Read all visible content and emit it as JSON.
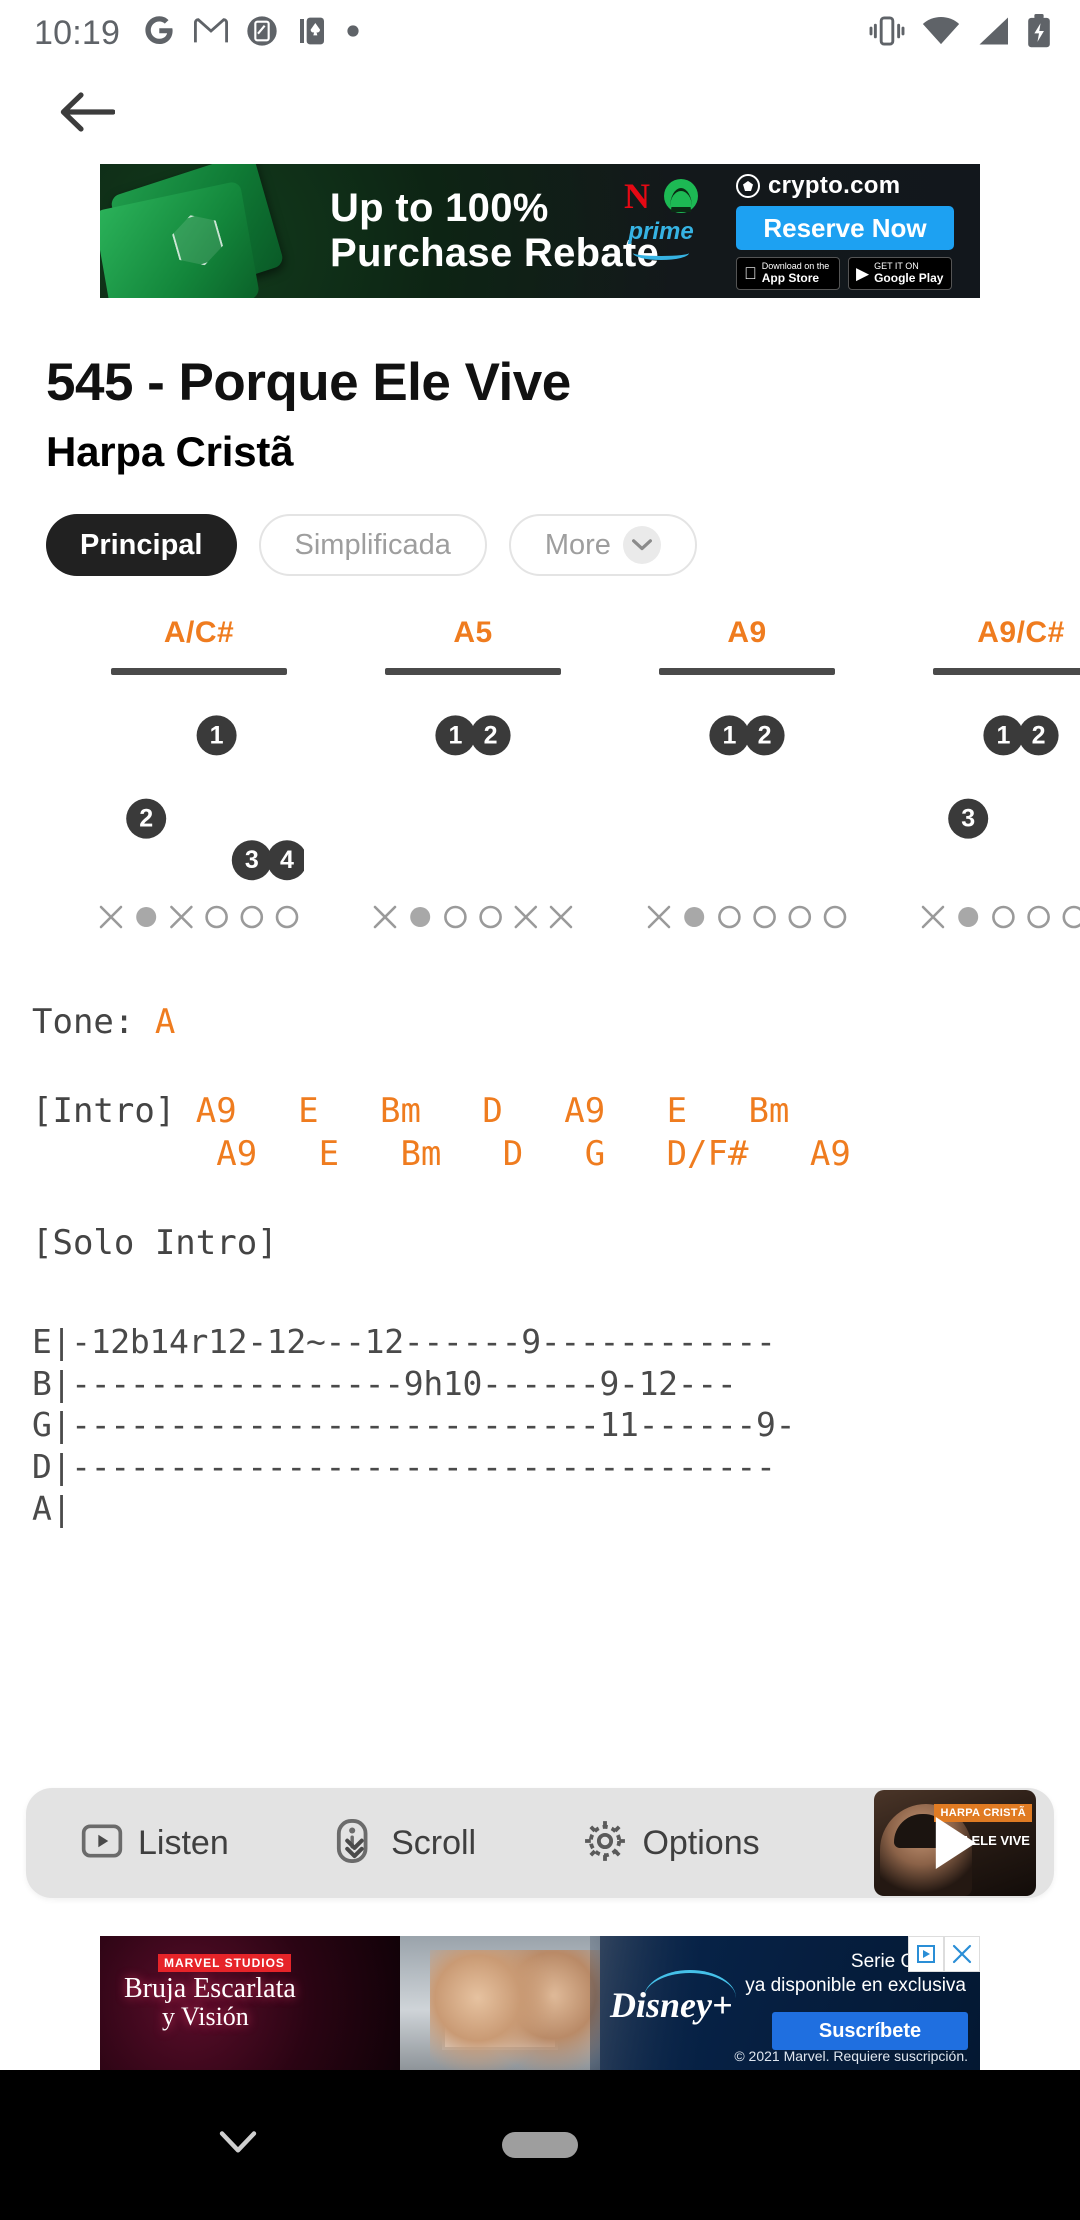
{
  "colors": {
    "accent_orange": "#ef7c1f",
    "text_dark": "#111111",
    "text_muted": "#9e9e9e",
    "tab_active_bg": "#212121",
    "toolbar_bg": "#e3e3e3",
    "tab_text": "#4a4a4a"
  },
  "status_bar": {
    "time": "10:19",
    "left_icons": [
      "google-icon",
      "gmail-icon",
      "screenshot-icon",
      "solitaire-icon",
      "more-dot-icon"
    ],
    "right_icons": [
      "vibrate-icon",
      "wifi-icon",
      "signal-icon",
      "battery-charging-icon"
    ]
  },
  "top_bar": {
    "back_icon": "arrow-left-icon"
  },
  "ad_top": {
    "headline_line1": "Up to 100%",
    "headline_line2": "Purchase Rebate",
    "brand": "crypto.com",
    "cta": "Reserve Now",
    "partner_logos": [
      "netflix-logo",
      "spotify-logo",
      "prime-logo"
    ],
    "store_badges": [
      {
        "pre": "Download on the",
        "name": "App Store",
        "icon": "apple-icon"
      },
      {
        "pre": "GET IT ON",
        "name": "Google Play",
        "icon": "play-store-icon"
      }
    ]
  },
  "song": {
    "title": "545 - Porque Ele Vive",
    "artist": "Harpa Cristã"
  },
  "tabs": [
    {
      "label": "Principal",
      "active": true
    },
    {
      "label": "Simplificada",
      "active": false
    },
    {
      "label": "More",
      "active": false,
      "icon": "chevron-down-icon"
    }
  ],
  "chords": [
    {
      "name": "A/C#",
      "strings": 6,
      "frets": 5,
      "fingers": [
        {
          "string": 4,
          "fret": 2,
          "num": "1"
        },
        {
          "string": 2,
          "fret": 4,
          "num": "2"
        },
        {
          "string": 5,
          "fret": 5,
          "num": "3"
        },
        {
          "string": 6,
          "fret": 5,
          "num": "4"
        }
      ],
      "open_markers": [
        "x",
        "dot",
        "x",
        "o",
        "o",
        "o"
      ]
    },
    {
      "name": "A5",
      "strings": 6,
      "frets": 5,
      "fingers": [
        {
          "string": 3,
          "fret": 2,
          "num": "1"
        },
        {
          "string": 4,
          "fret": 2,
          "num": "2"
        }
      ],
      "open_markers": [
        "x",
        "dot",
        "o",
        "o",
        "x",
        "x"
      ]
    },
    {
      "name": "A9",
      "strings": 6,
      "frets": 5,
      "fingers": [
        {
          "string": 3,
          "fret": 2,
          "num": "1"
        },
        {
          "string": 4,
          "fret": 2,
          "num": "2"
        }
      ],
      "open_markers": [
        "x",
        "dot",
        "o",
        "o",
        "o",
        "o"
      ]
    },
    {
      "name": "A9/C#",
      "strings": 6,
      "frets": 5,
      "fingers": [
        {
          "string": 3,
          "fret": 2,
          "num": "1"
        },
        {
          "string": 4,
          "fret": 2,
          "num": "2"
        },
        {
          "string": 2,
          "fret": 4,
          "num": "3"
        }
      ],
      "open_markers": [
        "x",
        "dot",
        "o",
        "o",
        "o",
        "x"
      ]
    }
  ],
  "sheet": {
    "tone_label": "Tone: ",
    "tone_value": "A",
    "intro_label": "[Intro] ",
    "intro_row1": "A9   E   Bm   D   A9   E   Bm",
    "intro_row2_indent": "         ",
    "intro_row2": "A9   E   Bm   D   G   D/F#   A9",
    "solo_label": "[Solo Intro]",
    "tab_lines": [
      "E|-12b14r12-12~--12------9------------",
      "B|-----------------9h10------9-12---",
      "G|---------------------------11------9-",
      "D|------------------------------------",
      "A|"
    ]
  },
  "toolbar": {
    "listen_label": "Listen",
    "listen_icon": "play-box-icon",
    "scroll_label": "Scroll",
    "scroll_icon": "scroll-down-icon",
    "options_label": "Options",
    "options_icon": "gear-icon",
    "thumbnail": {
      "badge": "HARPA CRISTÃ",
      "title": "QUE ELE VIVE",
      "play_icon": "play-icon"
    }
  },
  "ad_bottom": {
    "studio": "MARVEL STUDIOS",
    "title_line1": "Bruja Escarlata",
    "title_line2": "y Visión",
    "brand": "Disney+",
    "copy_line1": "Serie Original",
    "copy_line2": "ya disponible en exclusiva",
    "cta": "Suscríbete",
    "legal": "© 2021 Marvel. Requiere suscripción.",
    "controls": [
      "adchoices-icon",
      "close-icon"
    ]
  },
  "nav_bar": {
    "chevron_icon": "chevron-down-icon",
    "home_pill": "home-pill-handle"
  }
}
